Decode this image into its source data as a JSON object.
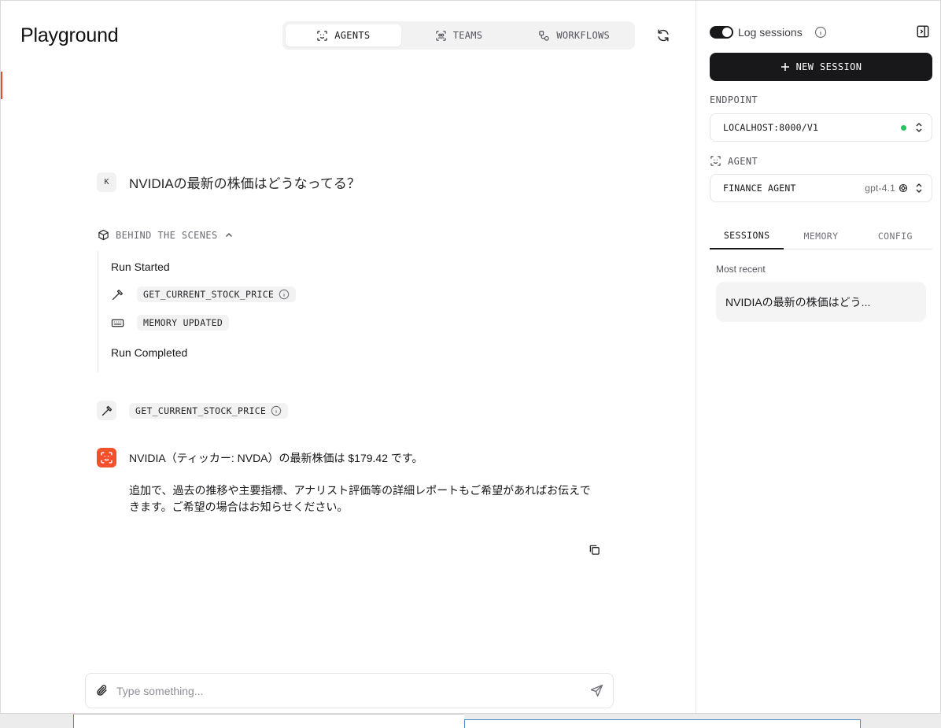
{
  "app": {
    "title": "Playground"
  },
  "modes": [
    {
      "label": "AGENTS",
      "icon": "agent-scan-icon",
      "active": true
    },
    {
      "label": "TEAMS",
      "icon": "team-scan-icon",
      "active": false
    },
    {
      "label": "WORKFLOWS",
      "icon": "workflow-icon",
      "active": false
    }
  ],
  "chat": {
    "user_avatar": "K",
    "user_message": "NVIDIAの最新の株価はどうなってる？",
    "behind_the_scenes": {
      "label": "BEHIND THE SCENES",
      "run_started": "Run Started",
      "tool_call": "GET_CURRENT_STOCK_PRICE",
      "memory": "MEMORY UPDATED",
      "run_completed": "Run Completed"
    },
    "tool_call": "GET_CURRENT_STOCK_PRICE",
    "agent_reply": [
      "NVIDIA（ティッカー: NVDA）の最新株価は $179.42 です。",
      "追加で、過去の推移や主要指標、アナリスト評価等の詳細レポートもご希望があればお伝えできます。ご希望の場合はお知らせください。"
    ]
  },
  "input": {
    "placeholder": "Type something..."
  },
  "sidebar": {
    "log_sessions": "Log sessions",
    "new_session": "NEW SESSION",
    "endpoint_label": "ENDPOINT",
    "endpoint_value": "LOCALHOST:8000/V1",
    "agent_label": "AGENT",
    "agent_value": "FINANCE AGENT",
    "model": "gpt-4.1",
    "tabs": [
      "SESSIONS",
      "MEMORY",
      "CONFIG"
    ],
    "active_tab": "SESSIONS",
    "recent_label": "Most recent",
    "sessions": [
      "NVIDIAの最新の株価はどう..."
    ]
  },
  "colors": {
    "accent": "#f0522a",
    "status": "#22c55e",
    "primary": "#18181b"
  }
}
